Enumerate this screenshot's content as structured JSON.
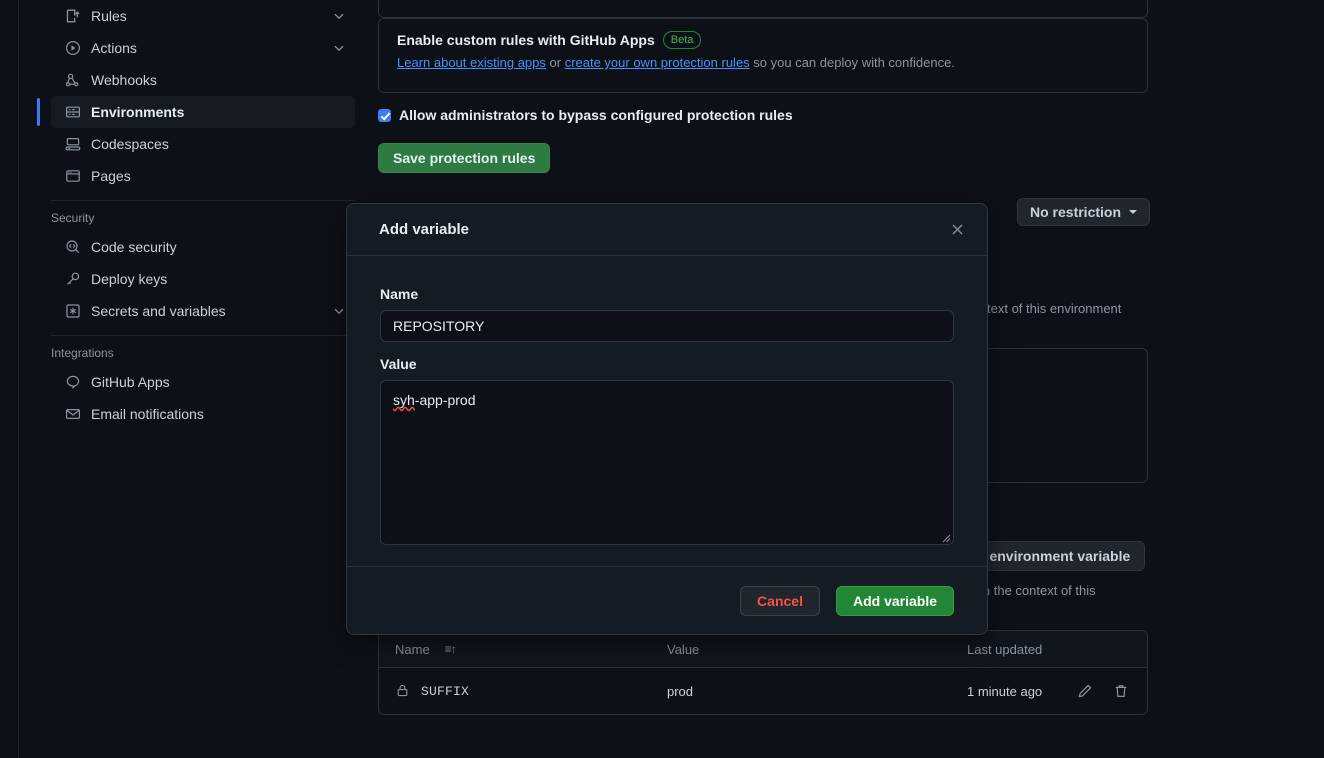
{
  "sidebar": {
    "items": [
      {
        "label": "Rules",
        "icon": "rules-icon",
        "chevron": true,
        "active": false
      },
      {
        "label": "Actions",
        "icon": "play-icon",
        "chevron": true,
        "active": false
      },
      {
        "label": "Webhooks",
        "icon": "webhook-icon",
        "chevron": false,
        "active": false
      },
      {
        "label": "Environments",
        "icon": "server-icon",
        "chevron": false,
        "active": true
      },
      {
        "label": "Codespaces",
        "icon": "codespaces-icon",
        "chevron": false,
        "active": false
      },
      {
        "label": "Pages",
        "icon": "browser-icon",
        "chevron": false,
        "active": false
      }
    ],
    "security_heading": "Security",
    "security_items": [
      {
        "label": "Code security",
        "icon": "code-scan-icon",
        "chevron": false
      },
      {
        "label": "Deploy keys",
        "icon": "key-icon",
        "chevron": false
      },
      {
        "label": "Secrets and variables",
        "icon": "asterisk-icon",
        "chevron": true
      }
    ],
    "integrations_heading": "Integrations",
    "integration_items": [
      {
        "label": "GitHub Apps",
        "icon": "apps-icon",
        "chevron": false
      },
      {
        "label": "Email notifications",
        "icon": "mail-icon",
        "chevron": false
      }
    ]
  },
  "main": {
    "rules_box": {
      "title": "Enable custom rules with GitHub Apps",
      "badge": "Beta",
      "link1": "Learn about existing apps",
      "between": " or ",
      "link2": "create your own protection rules",
      "tail": " so you can deploy with confidence."
    },
    "bypass_checkbox_label": "Allow administrators to bypass configured protection rules",
    "save_button": "Save protection rules",
    "no_restriction_button": "No restriction",
    "bg_text_1": "text of this environment",
    "bg_button": "d environment variable",
    "bg_text_2": "in the context of this"
  },
  "table": {
    "columns": [
      "Name",
      "Value",
      "Last updated"
    ],
    "sort_indicator": "≡↑",
    "rows": [
      {
        "lock_icon": "lock-icon",
        "name": "SUFFIX",
        "value": "prod",
        "updated": "1 minute ago",
        "edit_icon": "pencil-icon",
        "delete_icon": "trash-icon"
      }
    ]
  },
  "modal": {
    "title": "Add variable",
    "close_icon": "close-icon",
    "name_label": "Name",
    "name_value": "REPOSITORY",
    "value_label": "Value",
    "value_text": "syh-app-prod",
    "value_misspelled_part": "syh",
    "value_rest": "-app-prod",
    "cancel_button": "Cancel",
    "submit_button": "Add variable"
  },
  "colors": {
    "page_bg": "#0d1117",
    "modal_bg": "#151b23",
    "accent_blue": "#3d7cf3",
    "green": "#238636",
    "danger_red": "#f85149",
    "muted": "#8b949e"
  }
}
